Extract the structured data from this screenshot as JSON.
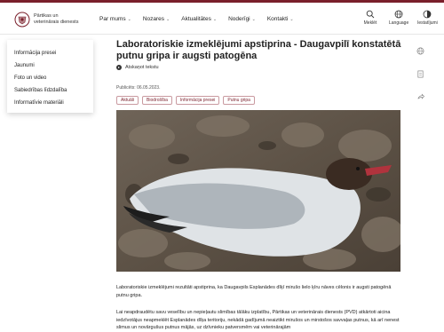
{
  "brand": {
    "name_line1": "Pārtikas un",
    "name_line2": "veterinārais dienests",
    "accent_color": "#7a1f2b"
  },
  "nav": {
    "items": [
      {
        "label": "Par mums"
      },
      {
        "label": "Nozares"
      },
      {
        "label": "Aktualitātes"
      },
      {
        "label": "Noderīgi"
      },
      {
        "label": "Kontakti"
      }
    ]
  },
  "tools": {
    "search": "Meklēt",
    "language": "Language",
    "settings": "Iestatījumi"
  },
  "dropdown": {
    "items": [
      "Informācija presei",
      "Jaunumi",
      "Foto un video",
      "Sabiedrības līdzdalība",
      "Informatīvie materiāli"
    ]
  },
  "article": {
    "title": "Laboratoriskie izmeklējumi apstiprina - Daugavpilī konstatētā putnu gripa ir augsti patogēna",
    "listen_label": "Atskaņot tekstu",
    "published": "Publicēts: 06.05.2023.",
    "tags": [
      "Aktuāli",
      "Biodrošība",
      "Informācija presei",
      "Putnu gripa"
    ],
    "paragraph1": "Laboratoriskie izmeklējumi rezultāti apstiprina, ka Daugavpils Esplanādes dīķī mirušo lielo ķīru nāves cēlonis ir augsti patogēnā putnu gripa.",
    "paragraph2": "Lai neapdraudētu savu veselību un nepieļautu slimības tālāku izplatību, Pārtikas un veterinārais dienests (PVD) atkārtoti aicina iedzīvotājus neapmeklēt Esplanādes dīķa teritoriju, nekādā gadījumā neaiztikt mirušos un mirstošos savvaļas putnus, kā arī nenest slimus un novārgušus putnus mājās, uz dzīvnieku patversmēm vai veterinārajām"
  }
}
